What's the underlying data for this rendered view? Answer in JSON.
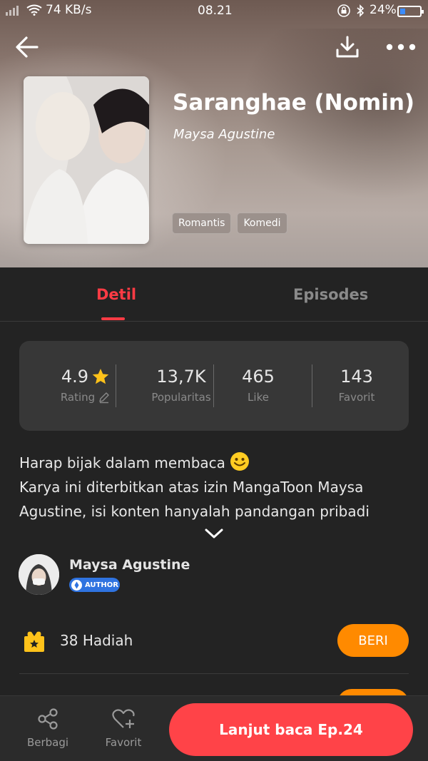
{
  "status_bar": {
    "network_speed": "74 KB/s",
    "time": "08.21",
    "battery": "24%"
  },
  "book": {
    "title": "Saranghae (Nomin)",
    "author": "Maysa Agustine",
    "tags": [
      "Romantis",
      "Komedi"
    ]
  },
  "tabs": {
    "detail": "Detil",
    "episodes": "Episodes"
  },
  "stats": {
    "rating_value": "4.9",
    "rating_label": "Rating",
    "popularity_value": "13,7K",
    "popularity_label": "Popularitas",
    "like_value": "465",
    "like_label": "Like",
    "favorite_value": "143",
    "favorite_label": "Favorit"
  },
  "description": {
    "line1": "Harap bijak dalam membaca",
    "line2": "Karya ini diterbitkan atas izin MangaToon Maysa",
    "line3": "Agustine, isi konten hanyalah pandangan pribadi"
  },
  "author_card": {
    "name": "Maysa Agustine",
    "badge": "AUTHOR"
  },
  "gift": {
    "count": "38",
    "label": "Hadiah",
    "button": "BERI"
  },
  "bottom_bar": {
    "share": "Berbagi",
    "favorite": "Favorit",
    "continue": "Lanjut baca Ep.24"
  },
  "colors": {
    "accent_red": "#ff3b44",
    "accent_orange": "#ff8a00",
    "star_yellow": "#ffc21a",
    "author_badge_blue": "#2f73e0"
  },
  "icons": [
    "back-arrow-icon",
    "download-icon",
    "more-icon",
    "star-icon",
    "edit-icon",
    "chevron-down-icon",
    "gift-icon",
    "share-icon",
    "heart-plus-icon",
    "author-badge-icon",
    "emoji-smile-icon"
  ]
}
